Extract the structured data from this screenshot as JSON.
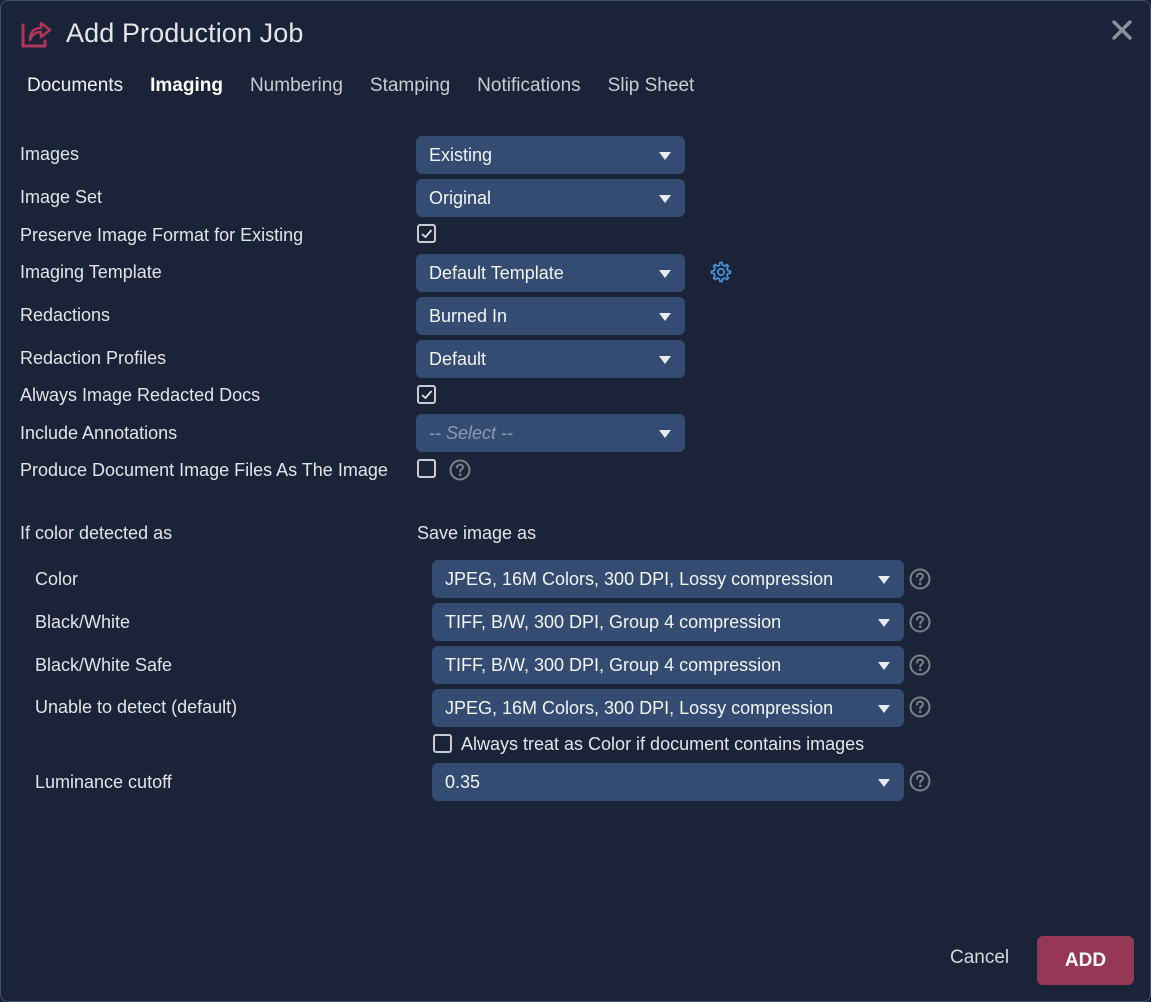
{
  "dialog": {
    "title": "Add Production Job",
    "icon": "share-export-icon",
    "close_icon": "close-icon"
  },
  "tabs": [
    {
      "label": "Documents",
      "active": false
    },
    {
      "label": "Imaging",
      "active": true
    },
    {
      "label": "Numbering",
      "active": false
    },
    {
      "label": "Stamping",
      "active": false
    },
    {
      "label": "Notifications",
      "active": false
    },
    {
      "label": "Slip Sheet",
      "active": false
    }
  ],
  "fields": {
    "images": {
      "label": "Images",
      "value": "Existing"
    },
    "image_set": {
      "label": "Image Set",
      "value": "Original"
    },
    "preserve_format": {
      "label": "Preserve Image Format for Existing",
      "checked": true
    },
    "imaging_template": {
      "label": "Imaging Template",
      "value": "Default Template",
      "settings_icon": "gear-icon"
    },
    "redactions": {
      "label": "Redactions",
      "value": "Burned In"
    },
    "redaction_profiles": {
      "label": "Redaction Profiles",
      "value": "Default"
    },
    "always_image_redacted": {
      "label": "Always Image Redacted Docs",
      "checked": true
    },
    "include_annotations": {
      "label": "Include Annotations",
      "placeholder": "-- Select --"
    },
    "produce_doc_image_files": {
      "label": "Produce Document Image Files As The Image",
      "checked": false,
      "help_icon": "help-circle-icon"
    }
  },
  "color_section": {
    "left_header": "If color detected as",
    "right_header": "Save image as",
    "rows": [
      {
        "label": "Color",
        "value": "JPEG, 16M Colors, 300 DPI, Lossy compression"
      },
      {
        "label": "Black/White",
        "value": "TIFF, B/W, 300 DPI, Group 4 compression"
      },
      {
        "label": "Black/White Safe",
        "value": "TIFF, B/W, 300 DPI, Group 4 compression"
      },
      {
        "label": "Unable to detect (default)",
        "value": "JPEG, 16M Colors, 300 DPI, Lossy compression"
      }
    ],
    "always_treat_color": {
      "label": "Always treat as Color if document contains images",
      "checked": false
    },
    "luminance": {
      "label": "Luminance cutoff",
      "value": "0.35"
    }
  },
  "footer": {
    "cancel_label": "Cancel",
    "add_label": "ADD"
  },
  "colors": {
    "background": "#1a2338",
    "select_bg": "#344c72",
    "accent": "#963756",
    "icon_brand": "#b0355a",
    "gear": "#4a90d9"
  }
}
